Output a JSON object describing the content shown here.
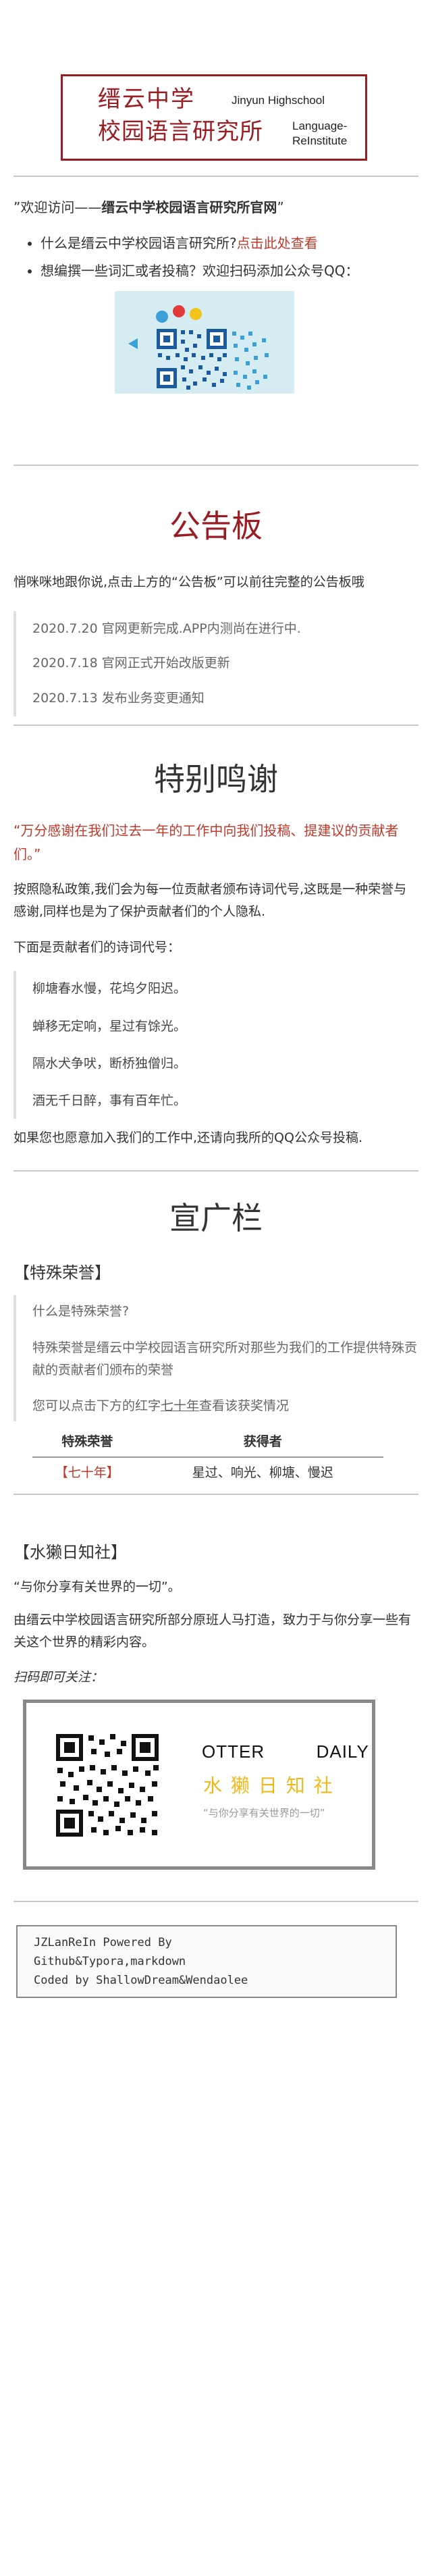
{
  "logo": {
    "cn_line1": "缙云中学",
    "cn_line2": "校园语言研究所",
    "en_line1": "Jinyun Highschool",
    "en_line2": "Language-",
    "en_line3": "ReInstitute"
  },
  "welcome": {
    "prefix": "”欢迎访问——",
    "bold": "缙云中学校园语言研究所官网",
    "suffix": "”"
  },
  "intro": {
    "item1_text": "什么是缙云中学校园语言研究所?",
    "item1_link": "点击此处查看",
    "item2_text": "想编撰一些词汇或者投稿？欢迎扫码添加公众号QQ："
  },
  "bulletin": {
    "title": "公告板",
    "desc": "悄咪咪地跟你说,点击上方的“公告板”可以前往完整的公告板哦",
    "items": [
      "2020.7.20 官网更新完成.APP内测尚在进行中.",
      "2020.7.18 官网正式开始改版更新",
      "2020.7.13 发布业务变更通知"
    ]
  },
  "thanks": {
    "title": "特别鸣谢",
    "red_quote": "“万分感谢在我们过去一年的工作中向我们投稿、提建议的贡献者们。”",
    "para1": "按照隐私政策,我们会为每一位贡献者颁布诗词代号,这既是一种荣誉与感谢,同样也是为了保护贡献者们的个人隐私.",
    "para2": "下面是贡献者们的诗词代号：",
    "poems": [
      "柳塘春水慢，花坞夕阳迟。",
      "蝉移无定响，星过有馀光。",
      "隔水犬争吠，断桥独僧归。",
      "酒无千日醉，事有百年忙。"
    ],
    "para3": "如果您也愿意加入我们的工作中,还请向我所的QQ公众号投稿."
  },
  "promo": {
    "title": "宣广栏",
    "honor_heading": "【特殊荣誉】",
    "honor_q": "什么是特殊荣誉?",
    "honor_a": "特殊荣誉是缙云中学校园语言研究所对那些为我们的工作提供特殊贡献的贡献者们颁布的荣誉",
    "honor_hint_pre": "您可以点击下方的红字",
    "honor_hint_link": "七十年",
    "honor_hint_post": "查看该获奖情况",
    "table_headers": [
      "特殊荣誉",
      "获得者"
    ],
    "table_rows": [
      [
        "【七十年】",
        "星过、响光、柳塘、慢迟"
      ]
    ],
    "otter_heading": "【水獭日知社】",
    "otter_quote": "“与你分享有关世界的一切”。",
    "otter_desc": "由缙云中学校园语言研究所部分原班人马打造，致力于与你分享一些有关这个世界的精彩内容。",
    "scan_hint": "扫码即可关注：",
    "otter_brand_en1": "OTTER",
    "otter_brand_en2": "DAILY",
    "otter_brand_cn": "水 獭 日 知 社",
    "otter_brand_slogan": "“与你分享有关世界的一切”"
  },
  "footer": {
    "line1": "JZLanReIn Powered By",
    "line2": "Github&Typora,markdown",
    "line3": "Coded by ShallowDream&Wendaolee"
  },
  "colors": {
    "brand_red": "#9b1c23",
    "link_red": "#c0392b",
    "otter_yellow": "#f0b91e"
  }
}
